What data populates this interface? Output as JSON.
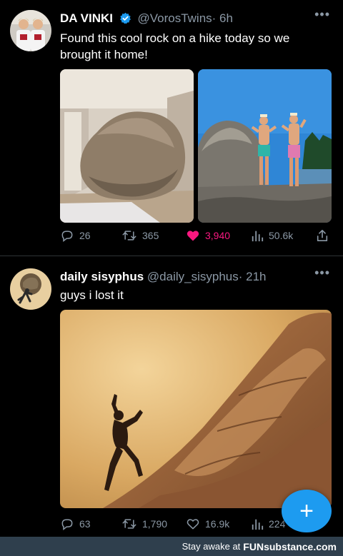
{
  "tweets": [
    {
      "display_name": "DA VINKI",
      "handle": "@VorosTwins",
      "time": "· 6h",
      "text": "Found this cool rock on a hike today so we brought it home!",
      "stats": {
        "replies": "26",
        "retweets": "365",
        "likes": "3,940",
        "views": "50.6k"
      },
      "liked": true
    },
    {
      "display_name": "daily sisyphus",
      "handle": "@daily_sisyphus",
      "time": "· 21h",
      "text": "guys i lost it",
      "stats": {
        "replies": "63",
        "retweets": "1,790",
        "likes": "16.9k",
        "views": "224"
      },
      "liked": false
    }
  ],
  "fab": {
    "label": "+"
  },
  "footer": {
    "text": "Stay awake at",
    "brand": "FUNsubstance.com"
  },
  "colors": {
    "like": "#f91880",
    "accent": "#1d9bf0",
    "muted": "#8b98a5"
  }
}
